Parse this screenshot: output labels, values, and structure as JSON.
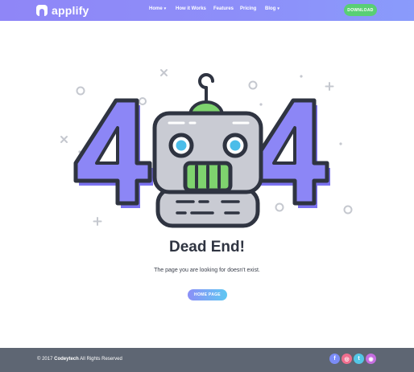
{
  "brand": {
    "name": "applify"
  },
  "nav": {
    "items": [
      {
        "label": "Home",
        "caret": "▾"
      },
      {
        "label": "How it Works"
      },
      {
        "label": "Features"
      },
      {
        "label": "Pricing"
      },
      {
        "label": "Blog",
        "caret": "▾"
      }
    ],
    "download_label": "DOWNLOAD"
  },
  "main": {
    "error_digits": [
      "4",
      "4"
    ],
    "title": "Dead End!",
    "subtitle": "The page you are looking for doesn't exist.",
    "home_button_label": "HOME PAGE"
  },
  "footer": {
    "copyright_prefix": "© 2017 ",
    "copyright_brand": "Codeytech",
    "copyright_suffix": " All Rights Reserved",
    "social": [
      {
        "icon": "facebook-icon",
        "glyph": "f",
        "color": "#7b8cf6"
      },
      {
        "icon": "instagram-icon",
        "glyph": "◎",
        "color": "#f06e8e"
      },
      {
        "icon": "twitter-icon",
        "glyph": "t",
        "color": "#53c6e6"
      },
      {
        "icon": "dribbble-icon",
        "glyph": "◉",
        "color": "#c66ee0"
      }
    ]
  },
  "colors": {
    "nav_gradient_start": "#8f86f7",
    "accent_purple": "#7b72f0",
    "download_green": "#59cf74",
    "footer_bg": "#5e6673",
    "title_color": "#2f3441"
  }
}
